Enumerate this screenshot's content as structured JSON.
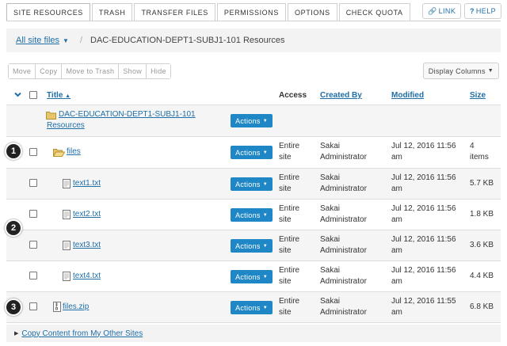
{
  "tabs": [
    {
      "label": "SITE RESOURCES"
    },
    {
      "label": "TRASH"
    },
    {
      "label": "TRANSFER FILES"
    },
    {
      "label": "PERMISSIONS"
    },
    {
      "label": "OPTIONS"
    },
    {
      "label": "CHECK QUOTA"
    }
  ],
  "header_buttons": {
    "link": "LINK",
    "help": "HELP"
  },
  "breadcrumb": {
    "root": "All site files",
    "current": "DAC-EDUCATION-DEPT1-SUBJ1-101 Resources"
  },
  "toolbar": [
    "Move",
    "Copy",
    "Move to Trash",
    "Show",
    "Hide"
  ],
  "display_columns": "Display Columns",
  "columns": {
    "title": "Title",
    "access": "Access",
    "created_by": "Created By",
    "modified": "Modified",
    "size": "Size"
  },
  "actions_label": "Actions",
  "rows": [
    {
      "title": "DAC-EDUCATION-DEPT1-SUBJ1-101 Resources",
      "title_line1": "DAC-EDUCATION-DEPT1-SUBJ1-101",
      "title_line2": "Resources",
      "access1": "",
      "access2": "",
      "creator1": "",
      "creator2": "",
      "mod1": "",
      "mod2": "",
      "size1": "",
      "size2": "",
      "icon": "folder-icon"
    },
    {
      "title": "files",
      "access1": "Entire",
      "access2": "site",
      "creator1": "Sakai",
      "creator2": "Administrator",
      "mod1": "Jul 12, 2016 11:56",
      "mod2": "am",
      "size1": "4",
      "size2": "items",
      "icon": "open-folder-icon"
    },
    {
      "title": "text1.txt",
      "access1": "Entire",
      "access2": "site",
      "creator1": "Sakai",
      "creator2": "Administrator",
      "mod1": "Jul 12, 2016 11:56",
      "mod2": "am",
      "size1": "5.7 KB",
      "size2": "",
      "icon": "text-file-icon"
    },
    {
      "title": "text2.txt",
      "access1": "Entire",
      "access2": "site",
      "creator1": "Sakai",
      "creator2": "Administrator",
      "mod1": "Jul 12, 2016 11:56",
      "mod2": "am",
      "size1": "1.8 KB",
      "size2": "",
      "icon": "text-file-icon"
    },
    {
      "title": "text3.txt",
      "access1": "Entire",
      "access2": "site",
      "creator1": "Sakai",
      "creator2": "Administrator",
      "mod1": "Jul 12, 2016 11:56",
      "mod2": "am",
      "size1": "3.6 KB",
      "size2": "",
      "icon": "text-file-icon"
    },
    {
      "title": "text4.txt",
      "access1": "Entire",
      "access2": "site",
      "creator1": "Sakai",
      "creator2": "Administrator",
      "mod1": "Jul 12, 2016 11:56",
      "mod2": "am",
      "size1": "4.4 KB",
      "size2": "",
      "icon": "text-file-icon"
    },
    {
      "title": "files.zip",
      "access1": "Entire",
      "access2": "site",
      "creator1": "Sakai",
      "creator2": "Administrator",
      "mod1": "Jul 12, 2016 11:55",
      "mod2": "am",
      "size1": "6.8 KB",
      "size2": "",
      "icon": "zip-file-icon"
    }
  ],
  "badges": [
    "1",
    "2",
    "3"
  ],
  "bottom_link": "Copy Content from My Other Sites",
  "colors": {
    "link": "#1f6ea7",
    "actions": "#2087c6",
    "row_alt": "#f5f5f5"
  }
}
